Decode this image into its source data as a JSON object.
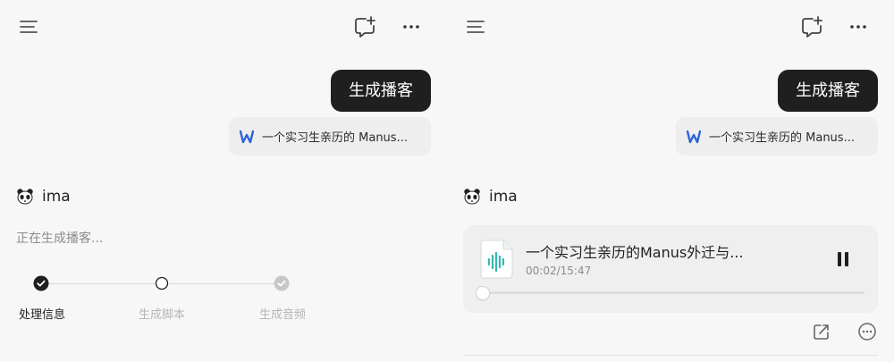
{
  "screens": [
    {
      "prompt_bubble": "生成播客",
      "attachment": {
        "icon": "word-document-icon",
        "name": "一个实习生亲历的 Manus..."
      },
      "assistant": {
        "icon": "panda-icon",
        "name": "ima"
      },
      "status": "正在生成播客...",
      "steps": [
        {
          "label": "处理信息",
          "state": "done"
        },
        {
          "label": "生成脚本",
          "state": "active"
        },
        {
          "label": "生成音频",
          "state": "pending"
        }
      ]
    },
    {
      "prompt_bubble": "生成播客",
      "attachment": {
        "icon": "word-document-icon",
        "name": "一个实习生亲历的 Manus..."
      },
      "assistant": {
        "icon": "panda-icon",
        "name": "ima"
      },
      "player": {
        "icon": "audio-file-icon",
        "title": "一个实习生亲历的Manus外迁与...",
        "time": "00:02/15:47",
        "progress_fraction": 0.0021
      },
      "actions": [
        {
          "icon": "share-icon"
        },
        {
          "icon": "more-circle-icon"
        }
      ]
    }
  ],
  "icons": {
    "topbar": [
      "menu-icon",
      "new-chat-icon",
      "more-icon"
    ]
  },
  "colors": {
    "background": "#f7f7f7",
    "bubble": "#1f1f1f",
    "chip": "#eeeeee",
    "word_blue": "#2b63d9",
    "teal": "#37b7b0",
    "muted_text": "#8b8b8b",
    "step_done": "#1f1f1f",
    "step_pending": "#c7c7c7"
  }
}
